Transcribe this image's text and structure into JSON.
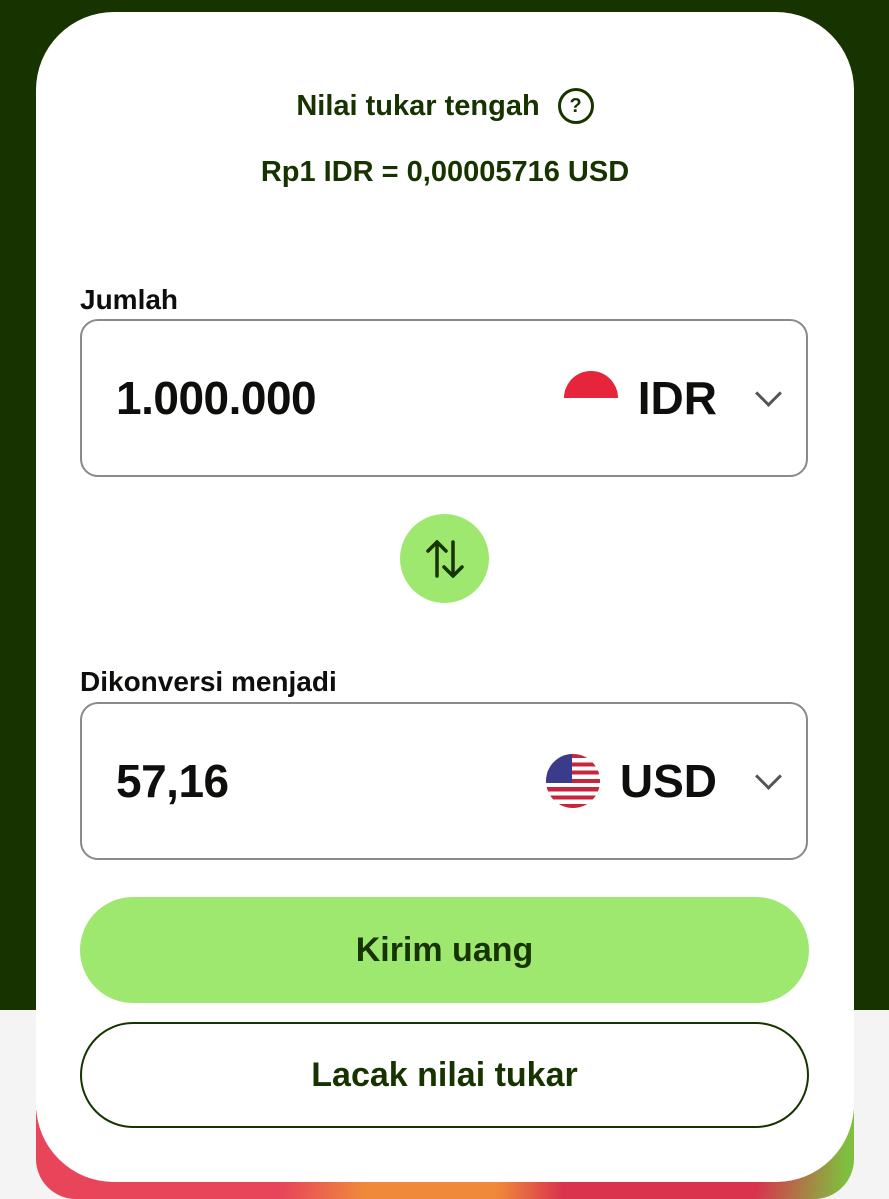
{
  "rate": {
    "label": "Nilai tukar tengah",
    "help_icon": "?",
    "value": "Rp1 IDR = 0,00005716 USD"
  },
  "source": {
    "label": "Jumlah",
    "amount": "1.000.000",
    "currency": "IDR",
    "flag_icon": "indonesia-flag-icon"
  },
  "swap": {
    "icon": "swap-arrows-icon"
  },
  "target": {
    "label": "Dikonversi menjadi",
    "amount": "57,16",
    "currency": "USD",
    "flag_icon": "usa-flag-icon"
  },
  "actions": {
    "send_label": "Kirim uang",
    "track_label": "Lacak nilai tukar"
  },
  "colors": {
    "brand_dark": "#163300",
    "brand_green": "#9fe870",
    "border": "#8a8a8a"
  }
}
